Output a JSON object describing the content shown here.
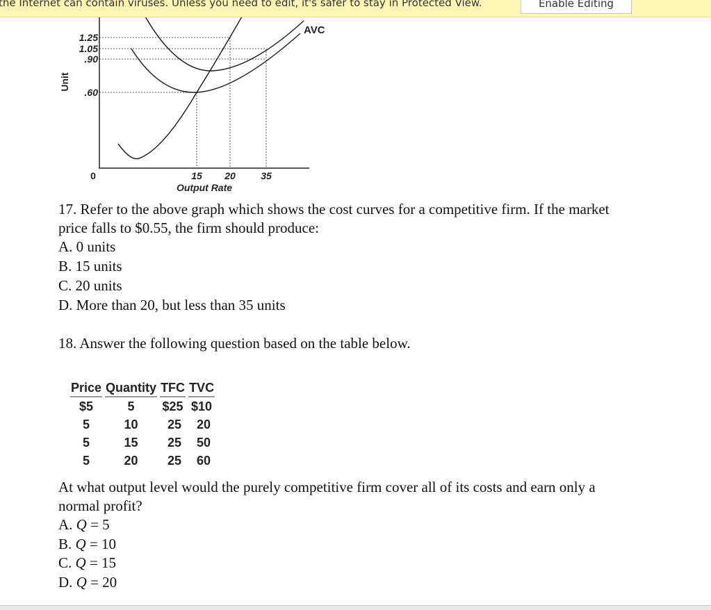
{
  "protected_view": {
    "message": "the Internet can contain viruses. Unless you need to edit, it's safer to stay in Protected View.",
    "enable_button": "Enable Editing"
  },
  "graph": {
    "y_label": "Unit",
    "x_label": "Output Rate",
    "y_ticks": [
      "1.25",
      "1.05",
      ".90",
      ".60"
    ],
    "x_ticks": [
      "0",
      "15",
      "20",
      "35"
    ],
    "curve_label": "AVC"
  },
  "q17": {
    "stem_line1": "17. Refer to the above graph which shows the cost curves for a competitive firm. If the market",
    "stem_line2": "price falls to $0.55, the firm should produce:",
    "options": [
      "A. 0 units",
      "B. 15 units",
      "C. 20 units",
      "D. More than 20, but less than 35 units"
    ]
  },
  "q18": {
    "stem": "18.  Answer the following question based on the table below.",
    "table": {
      "headers": [
        "Price",
        "Quantity",
        "TFC",
        "TVC"
      ],
      "rows": [
        [
          "$5",
          "5",
          "$25",
          "$10"
        ],
        [
          "5",
          "10",
          "25",
          "20"
        ],
        [
          "5",
          "15",
          "25",
          "50"
        ],
        [
          "5",
          "20",
          "25",
          "60"
        ]
      ]
    },
    "question_line1": "At what output level would the purely competitive firm cover all of its costs and earn only a",
    "question_line2": "normal profit?",
    "options": [
      {
        "letter": "A.",
        "var": "Q",
        "rest": " = 5"
      },
      {
        "letter": "B.",
        "var": "Q",
        "rest": " = 10"
      },
      {
        "letter": "C.",
        "var": "Q",
        "rest": " = 15"
      },
      {
        "letter": "D.",
        "var": "Q",
        "rest": " = 20"
      }
    ]
  }
}
